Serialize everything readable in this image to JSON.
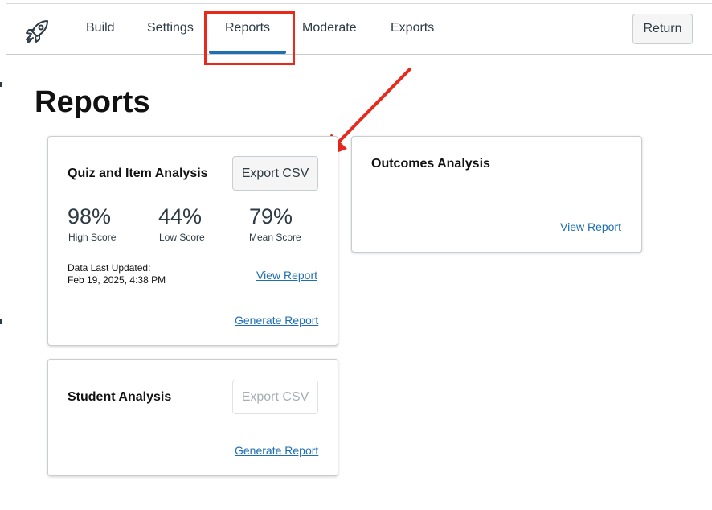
{
  "nav": {
    "tabs": [
      {
        "label": "Build"
      },
      {
        "label": "Settings"
      },
      {
        "label": "Reports",
        "active": true
      },
      {
        "label": "Moderate"
      },
      {
        "label": "Exports"
      }
    ],
    "return_label": "Return",
    "logo_icon": "rocket-icon",
    "accent_color": "#1d6fb1"
  },
  "annotation": {
    "highlight_color": "#e8291c",
    "highlighted_tab": "Reports",
    "arrow_target": "Export CSV"
  },
  "page": {
    "title": "Reports"
  },
  "quiz_card": {
    "title": "Quiz and Item Analysis",
    "export_label": "Export CSV",
    "stats": [
      {
        "value": "98%",
        "label": "High Score"
      },
      {
        "value": "44%",
        "label": "Low Score"
      },
      {
        "value": "79%",
        "label": "Mean Score"
      }
    ],
    "updated_label": "Data Last Updated:",
    "updated_value": "Feb 19, 2025, 4:38 PM",
    "view_report": "View Report",
    "generate_report": "Generate Report"
  },
  "outcomes_card": {
    "title": "Outcomes Analysis",
    "view_report": "View Report"
  },
  "student_card": {
    "title": "Student Analysis",
    "export_label": "Export CSV",
    "export_disabled": true,
    "generate_report": "Generate Report"
  }
}
